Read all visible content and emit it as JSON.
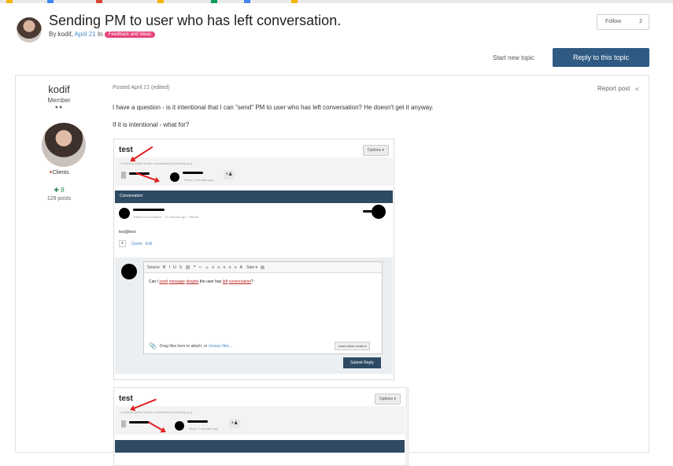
{
  "topic": {
    "title": "Sending PM to user who has left conversation.",
    "by_prefix": "By kodif,",
    "date": "April 21",
    "in_label": "In",
    "forum_badge": "Feedback and Ideas"
  },
  "actions": {
    "follow_label": "Follow",
    "follow_count": "2",
    "start_new_topic": "Start new topic",
    "reply_to_topic": "Reply to this topic"
  },
  "author": {
    "name": "kodif",
    "rank": "Member",
    "rank_pips": "●●",
    "group": "Clients",
    "group_prefix": "+",
    "reputation": "8",
    "posts": "129 posts"
  },
  "post": {
    "posted": "Posted April 21 (edited)",
    "report": "Report post",
    "paragraph1": "I have a question - is it intentional that I can \"send\" PM to user who has left conversation? He doesn't get it anyway.",
    "paragraph2": "If it is intentional - what for?"
  },
  "screenshot1": {
    "title": "test",
    "options": "Options ▾",
    "active_line": "1 member active in this conversation (including you)",
    "read_text": "Read: 2 minutes ago",
    "conversation_bar": "Conversation",
    "started": "Started conversation · 10 minutes ago · Report",
    "message": "test@test",
    "quote": "Quote",
    "edit": "Edit",
    "toolbar_source": "Source",
    "toolbar_size": "Size",
    "editor_text_pre": "Can I ",
    "editor_send": "send",
    "editor_message": "message",
    "editor_despite": "despite",
    "editor_mid": " the user has ",
    "editor_left": "left",
    "editor_conversation": "conversation",
    "editor_end": "?",
    "drag_text": "Drag files here to attach, or ",
    "choose_files": "choose files...",
    "insert_media": "Insert other media ▾",
    "submit": "Submit Reply"
  },
  "screenshot2": {
    "title": "test",
    "options": "Options ▾",
    "active_line": "1 member active in this conversation (including you)",
    "read_text": "Read: 2 minutes ago"
  },
  "colors": {
    "accent": "#2f5b83",
    "badge": "#e8437e",
    "annotation_arrow": "#e02020"
  }
}
